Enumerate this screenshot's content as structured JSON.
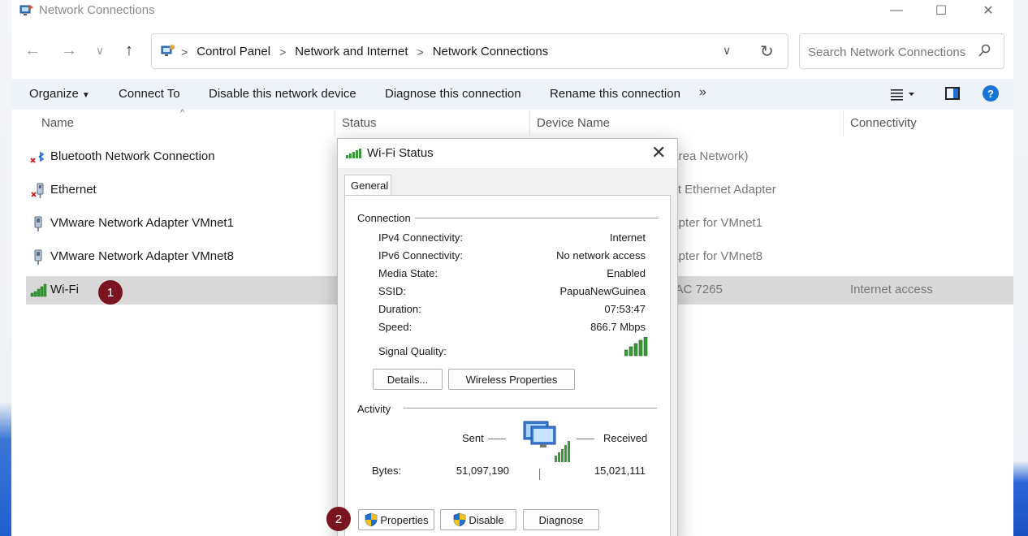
{
  "window": {
    "title": "Network Connections",
    "controls": {
      "minimize": "—",
      "maximize": "☐",
      "close": "✕"
    }
  },
  "address": {
    "breadcrumbs": [
      "Control Panel",
      "Network and Internet",
      "Network Connections"
    ],
    "separator": ">",
    "search_placeholder": "Search Network Connections"
  },
  "toolbar": {
    "organize": "Organize",
    "connect_to": "Connect To",
    "disable": "Disable this network device",
    "diagnose": "Diagnose this connection",
    "rename": "Rename this connection",
    "more": "»"
  },
  "columns": {
    "name": "Name",
    "status": "Status",
    "device": "Device Name",
    "connectivity": "Connectivity"
  },
  "rows": [
    {
      "name": "Bluetooth Network Connection",
      "device": "l Area Network)",
      "connectivity": "",
      "icon": "bluetooth-network-icon"
    },
    {
      "name": "Ethernet",
      "device": "ast Ethernet Adapter",
      "connectivity": "",
      "icon": "ethernet-disconnected-icon"
    },
    {
      "name": "VMware Network Adapter VMnet1",
      "device": "dapter for VMnet1",
      "connectivity": "",
      "icon": "network-adapter-icon"
    },
    {
      "name": "VMware Network Adapter VMnet8",
      "device": "dapter for VMnet8",
      "connectivity": "",
      "icon": "network-adapter-icon"
    },
    {
      "name": "Wi-Fi",
      "device": "s-AC 7265",
      "connectivity": "Internet access",
      "icon": "wifi-signal-icon",
      "selected": true
    }
  ],
  "markers": {
    "one": "1",
    "two": "2"
  },
  "dialog": {
    "title": "Wi-Fi Status",
    "close": "✕",
    "tab": "General",
    "connection_label": "Connection",
    "connection": [
      {
        "label": "IPv4 Connectivity:",
        "value": "Internet"
      },
      {
        "label": "IPv6 Connectivity:",
        "value": "No network access"
      },
      {
        "label": "Media State:",
        "value": "Enabled"
      },
      {
        "label": "SSID:",
        "value": "PapuaNewGuinea"
      },
      {
        "label": "Duration:",
        "value": "07:53:47"
      },
      {
        "label": "Speed:",
        "value": "866.7 Mbps"
      }
    ],
    "signal_label": "Signal Quality:",
    "details_button": "Details...",
    "wireless_button": "Wireless Properties",
    "activity_label": "Activity",
    "sent_label": "Sent",
    "received_label": "Received",
    "bytes_label": "Bytes:",
    "bytes_sent": "51,097,190",
    "bytes_received": "15,021,111",
    "properties_button": "Properties",
    "disable_button": "Disable",
    "diagnose_button": "Diagnose"
  },
  "colors": {
    "accent": "#1a73d6",
    "marker": "#7a1420",
    "selected_row": "#d9d9d9",
    "toolbar_bg": "#eef3f9",
    "signal_green": "#3a9a3a"
  }
}
